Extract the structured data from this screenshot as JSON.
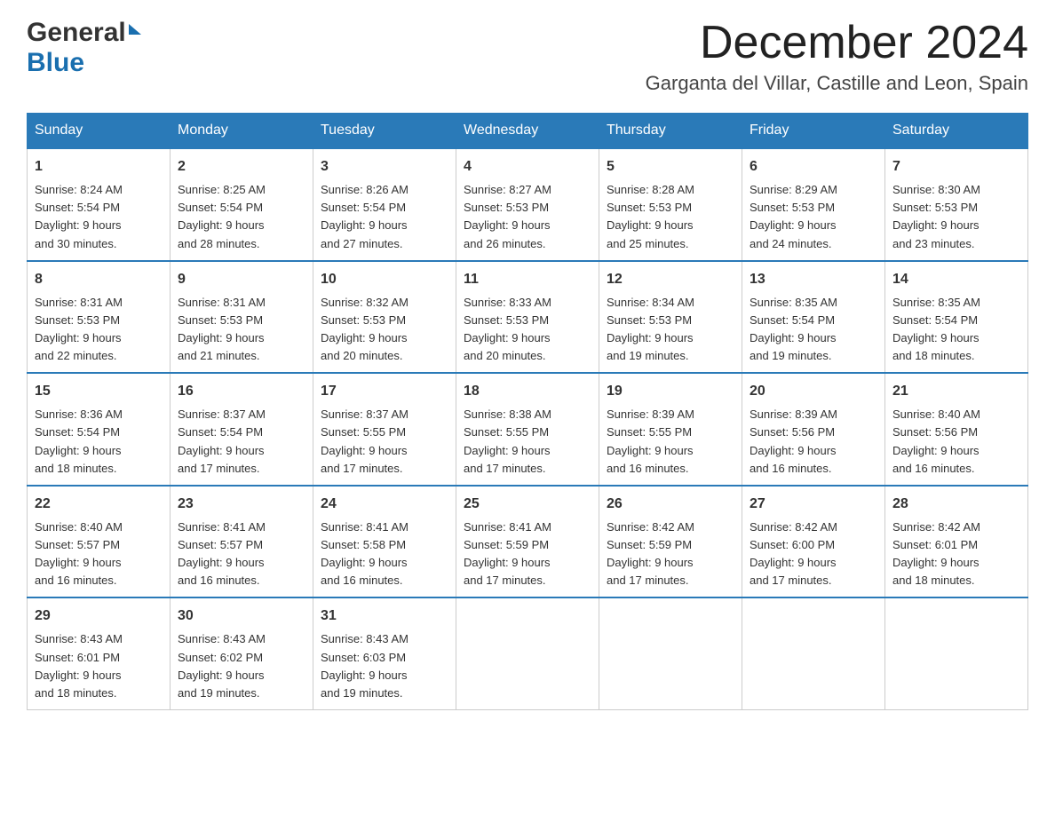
{
  "header": {
    "logo_general": "General",
    "logo_blue": "Blue",
    "month_title": "December 2024",
    "location": "Garganta del Villar, Castille and Leon, Spain"
  },
  "days_of_week": [
    "Sunday",
    "Monday",
    "Tuesday",
    "Wednesday",
    "Thursday",
    "Friday",
    "Saturday"
  ],
  "weeks": [
    [
      {
        "day": "1",
        "sunrise": "8:24 AM",
        "sunset": "5:54 PM",
        "daylight": "9 hours and 30 minutes."
      },
      {
        "day": "2",
        "sunrise": "8:25 AM",
        "sunset": "5:54 PM",
        "daylight": "9 hours and 28 minutes."
      },
      {
        "day": "3",
        "sunrise": "8:26 AM",
        "sunset": "5:54 PM",
        "daylight": "9 hours and 27 minutes."
      },
      {
        "day": "4",
        "sunrise": "8:27 AM",
        "sunset": "5:53 PM",
        "daylight": "9 hours and 26 minutes."
      },
      {
        "day": "5",
        "sunrise": "8:28 AM",
        "sunset": "5:53 PM",
        "daylight": "9 hours and 25 minutes."
      },
      {
        "day": "6",
        "sunrise": "8:29 AM",
        "sunset": "5:53 PM",
        "daylight": "9 hours and 24 minutes."
      },
      {
        "day": "7",
        "sunrise": "8:30 AM",
        "sunset": "5:53 PM",
        "daylight": "9 hours and 23 minutes."
      }
    ],
    [
      {
        "day": "8",
        "sunrise": "8:31 AM",
        "sunset": "5:53 PM",
        "daylight": "9 hours and 22 minutes."
      },
      {
        "day": "9",
        "sunrise": "8:31 AM",
        "sunset": "5:53 PM",
        "daylight": "9 hours and 21 minutes."
      },
      {
        "day": "10",
        "sunrise": "8:32 AM",
        "sunset": "5:53 PM",
        "daylight": "9 hours and 20 minutes."
      },
      {
        "day": "11",
        "sunrise": "8:33 AM",
        "sunset": "5:53 PM",
        "daylight": "9 hours and 20 minutes."
      },
      {
        "day": "12",
        "sunrise": "8:34 AM",
        "sunset": "5:53 PM",
        "daylight": "9 hours and 19 minutes."
      },
      {
        "day": "13",
        "sunrise": "8:35 AM",
        "sunset": "5:54 PM",
        "daylight": "9 hours and 19 minutes."
      },
      {
        "day": "14",
        "sunrise": "8:35 AM",
        "sunset": "5:54 PM",
        "daylight": "9 hours and 18 minutes."
      }
    ],
    [
      {
        "day": "15",
        "sunrise": "8:36 AM",
        "sunset": "5:54 PM",
        "daylight": "9 hours and 18 minutes."
      },
      {
        "day": "16",
        "sunrise": "8:37 AM",
        "sunset": "5:54 PM",
        "daylight": "9 hours and 17 minutes."
      },
      {
        "day": "17",
        "sunrise": "8:37 AM",
        "sunset": "5:55 PM",
        "daylight": "9 hours and 17 minutes."
      },
      {
        "day": "18",
        "sunrise": "8:38 AM",
        "sunset": "5:55 PM",
        "daylight": "9 hours and 17 minutes."
      },
      {
        "day": "19",
        "sunrise": "8:39 AM",
        "sunset": "5:55 PM",
        "daylight": "9 hours and 16 minutes."
      },
      {
        "day": "20",
        "sunrise": "8:39 AM",
        "sunset": "5:56 PM",
        "daylight": "9 hours and 16 minutes."
      },
      {
        "day": "21",
        "sunrise": "8:40 AM",
        "sunset": "5:56 PM",
        "daylight": "9 hours and 16 minutes."
      }
    ],
    [
      {
        "day": "22",
        "sunrise": "8:40 AM",
        "sunset": "5:57 PM",
        "daylight": "9 hours and 16 minutes."
      },
      {
        "day": "23",
        "sunrise": "8:41 AM",
        "sunset": "5:57 PM",
        "daylight": "9 hours and 16 minutes."
      },
      {
        "day": "24",
        "sunrise": "8:41 AM",
        "sunset": "5:58 PM",
        "daylight": "9 hours and 16 minutes."
      },
      {
        "day": "25",
        "sunrise": "8:41 AM",
        "sunset": "5:59 PM",
        "daylight": "9 hours and 17 minutes."
      },
      {
        "day": "26",
        "sunrise": "8:42 AM",
        "sunset": "5:59 PM",
        "daylight": "9 hours and 17 minutes."
      },
      {
        "day": "27",
        "sunrise": "8:42 AM",
        "sunset": "6:00 PM",
        "daylight": "9 hours and 17 minutes."
      },
      {
        "day": "28",
        "sunrise": "8:42 AM",
        "sunset": "6:01 PM",
        "daylight": "9 hours and 18 minutes."
      }
    ],
    [
      {
        "day": "29",
        "sunrise": "8:43 AM",
        "sunset": "6:01 PM",
        "daylight": "9 hours and 18 minutes."
      },
      {
        "day": "30",
        "sunrise": "8:43 AM",
        "sunset": "6:02 PM",
        "daylight": "9 hours and 19 minutes."
      },
      {
        "day": "31",
        "sunrise": "8:43 AM",
        "sunset": "6:03 PM",
        "daylight": "9 hours and 19 minutes."
      },
      null,
      null,
      null,
      null
    ]
  ],
  "labels": {
    "sunrise": "Sunrise:",
    "sunset": "Sunset:",
    "daylight": "Daylight:"
  }
}
